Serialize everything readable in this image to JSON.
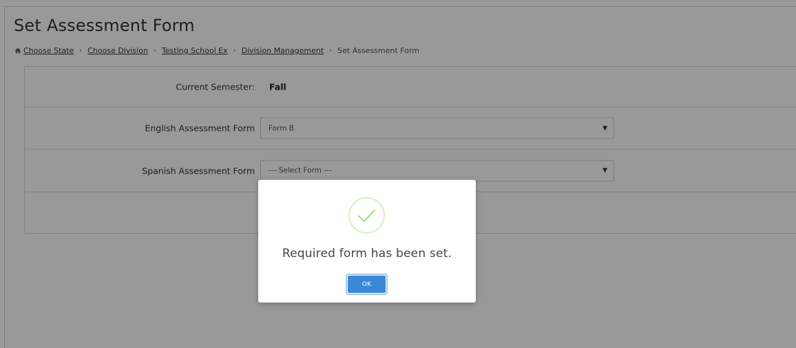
{
  "page": {
    "title": "Set Assessment Form"
  },
  "breadcrumb": {
    "icon": "home-icon",
    "items": [
      "Choose State",
      "Choose Division",
      "Testing School Ex",
      "Division Management"
    ],
    "separator": "›",
    "current": "Set Assessment Form"
  },
  "form": {
    "semester": {
      "label": "Current Semester:",
      "value": "Fall"
    },
    "english": {
      "label": "English Assessment Form",
      "selected": "Form B"
    },
    "spanish": {
      "label": "Spanish Assessment Form",
      "selected": "--- Select Form ---"
    },
    "caret": "▼"
  },
  "modal": {
    "icon": "checkmark-circle-icon",
    "message": "Required form has been set.",
    "ok_label": "OK"
  },
  "colors": {
    "success": "#a5dc86",
    "primary_button": "#3a89d6",
    "overlay": "rgba(0,0,0,0.4)"
  }
}
